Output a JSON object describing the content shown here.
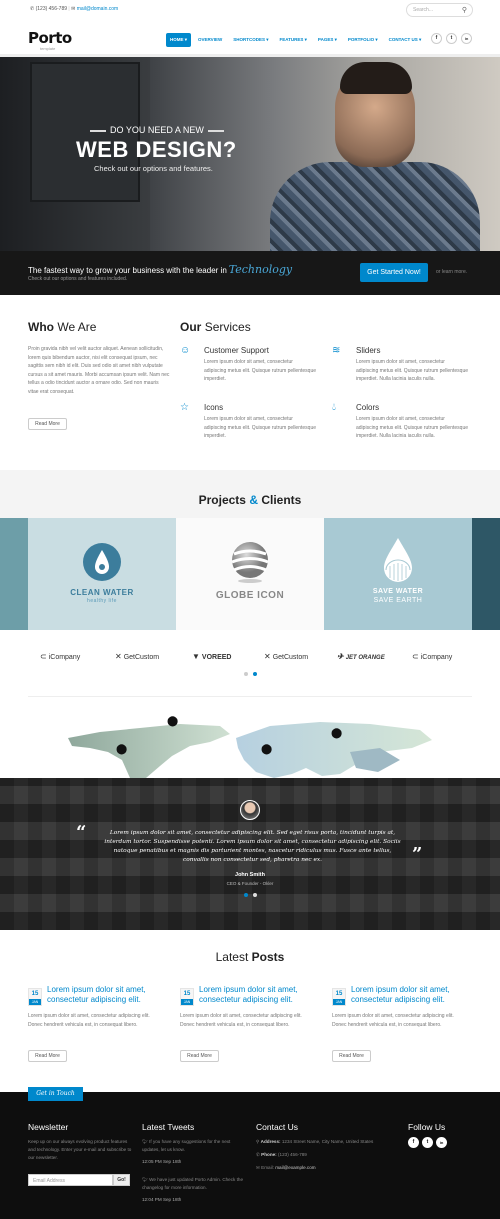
{
  "topbar": {
    "phone": "(123) 456-789",
    "email": "mail@domain.com"
  },
  "search": {
    "placeholder": "Search..."
  },
  "logo": {
    "name": "Porto",
    "tagline": "template"
  },
  "nav": [
    "HOME ▾",
    "OVERVIEW",
    "SHORTCODES ▾",
    "FEATURES ▾",
    "PAGES ▾",
    "PORTFOLIO ▾",
    "CONTACT US ▾"
  ],
  "header_social": [
    "f",
    "t",
    "in"
  ],
  "hero": {
    "kicker": "DO YOU NEED A NEW",
    "title": "WEB DESIGN?",
    "subtitle": "Check out our options and features."
  },
  "cta": {
    "lead": "The fastest way to grow your business with the leader in",
    "lead_accent": "Technology",
    "small": "Check out our options and features included.",
    "button": "Get Started Now!",
    "learn": "or learn more."
  },
  "who": {
    "title_bold": "Who",
    "title_rest": "We Are",
    "text": "Proin gravida nibh vel velit auctor aliquet. Aenean sollicitudin, lorem quis bibendum auctor, nisi elit consequat ipsum, nec sagittis sem nibh id elit. Duis sed odio sit amet nibh vulputate cursus a sit amet mauris. Morbi accumsan ipsum velit. Nam nec tellus a odio tincidunt auctor a ornare odio. Sed non mauris vitae erat consequat.",
    "button": "Read More"
  },
  "services": {
    "title_bold": "Our",
    "title_rest": "Services",
    "items": [
      {
        "icon": "users-icon",
        "name": "Customer Support",
        "desc": "Lorem ipsum dolor sit amet, consectetur adipiscing metus elit. Quisque rutrum pellentesque imperdiet."
      },
      {
        "icon": "layers-icon",
        "name": "Sliders",
        "desc": "Lorem ipsum dolor sit amet, consectetur adipiscing metus elit. Quisque rutrum pellentesque imperdiet. Nulla lacinia iaculis nulla."
      },
      {
        "icon": "star-icon",
        "name": "Icons",
        "desc": "Lorem ipsum dolor sit amet, consectetur adipiscing metus elit. Quisque rutrum pellentesque imperdiet."
      },
      {
        "icon": "drop-icon",
        "name": "Colors",
        "desc": "Lorem ipsum dolor sit amet, consectetur adipiscing metus elit. Quisque rutrum pellentesque imperdiet. Nulla lacinia iaculis nulla."
      }
    ]
  },
  "projects": {
    "title_a": "Projects",
    "amp": "&",
    "title_b": "Clients",
    "items": [
      {
        "label": "CLEAN WATER",
        "sub": "healthy life"
      },
      {
        "label": "GLOBE ICON",
        "sub": ""
      },
      {
        "label": "SAVE WATER",
        "sub": "SAVE EARTH"
      }
    ]
  },
  "clients": [
    "iCompany",
    "GetCustom",
    "VOREED",
    "GetCustom",
    "JET ORANGE",
    "iCompany"
  ],
  "testimonial": {
    "text": "Lorem ipsum dolor sit amet, consectetur adipiscing elit. Sed eget risus porta, tincidunt turpis at, interdum tortor. Suspendisse potenti. Lorem ipsum dolor sit amet, consectetur adipiscing elit. Sociis natoque penatibus et magnis dis parturient montes, nascetur ridiculus mus. Fusce ante tellus, convallis non consectetur sed, pharetra nec ex.",
    "name": "John Smith",
    "role": "CEO & Founder - Okler",
    "open_quote": "“",
    "close_quote": "”"
  },
  "posts": {
    "title_a": "Latest",
    "title_b": "Posts",
    "items": [
      {
        "day": "15",
        "month": "JAN",
        "title": "Lorem ipsum dolor sit amet, consectetur adipiscing elit.",
        "desc": "Lorem ipsum dolor sit amet, consectetur adipiscing elit. Donec hendrerit vehicula est, in consequat libero.",
        "button": "Read More"
      },
      {
        "day": "15",
        "month": "JAN",
        "title": "Lorem ipsum dolor sit amet, consectetur adipiscing elit.",
        "desc": "Lorem ipsum dolor sit amet, consectetur adipiscing elit. Donec hendrerit vehicula est, in consequat libero.",
        "button": "Read More"
      },
      {
        "day": "15",
        "month": "JAN",
        "title": "Lorem ipsum dolor sit amet, consectetur adipiscing elit.",
        "desc": "Lorem ipsum dolor sit amet, consectetur adipiscing elit. Donec hendrerit vehicula est, in consequat libero.",
        "button": "Read More"
      }
    ]
  },
  "footer": {
    "touch_tab": "Get in Touch",
    "newsletter": {
      "title": "Newsletter",
      "text": "Keep up on our always evolving product features and technology. Enter your e-mail and subscribe to our newsletter.",
      "placeholder": "Email Address",
      "button": "Go!"
    },
    "tweets": {
      "title": "Latest Tweets",
      "t1": "If you have any suggestions for the next updates, let us know.",
      "t1_time": "12:05 PM Sep 18th",
      "t2": "We have just updated Porto Admin. Check the changelog for more information.",
      "t2_time": "12:04 PM Sep 18th"
    },
    "contact": {
      "title": "Contact Us",
      "address_label": "Address:",
      "address": "1234 Street Name, City Name, United States",
      "phone_label": "Phone:",
      "phone": "(123) 456-789",
      "email_label": "Email:",
      "email": "mail@example.com"
    },
    "follow": {
      "title": "Follow Us",
      "icons": [
        "f",
        "t",
        "in"
      ]
    }
  }
}
